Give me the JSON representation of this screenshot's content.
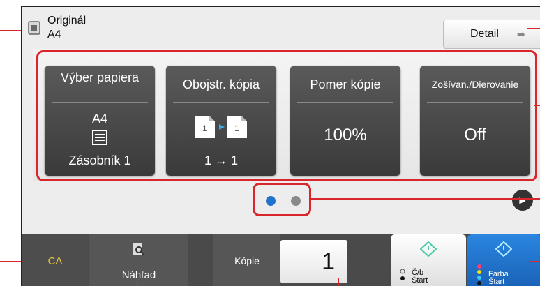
{
  "original": {
    "label": "Originál",
    "size": "A4"
  },
  "detail": {
    "label": "Detail"
  },
  "tiles": [
    {
      "title": "Výber papiera",
      "value": "A4",
      "sub": "Zásobník 1"
    },
    {
      "title": "Obojstr. kópia",
      "value": "",
      "sub": "1 → 1"
    },
    {
      "title": "Pomer kópie",
      "value": "100%",
      "sub": ""
    },
    {
      "title": "Zošívan./Dierovanie",
      "value": "Off",
      "sub": ""
    }
  ],
  "pager": {
    "pages": 2,
    "current": 1
  },
  "bottom": {
    "ca": "CA",
    "preview": "Náhľad",
    "copies_label": "Kópie",
    "copies_value": "1",
    "bw_start_line1": "Č/b",
    "bw_start_line2": "Štart",
    "color_start_line1": "Farba",
    "color_start_line2": "Štart"
  },
  "colors": {
    "highlight": "#d9262a",
    "accent_blue": "#1f73cc",
    "ca_yellow": "#e8c640"
  }
}
